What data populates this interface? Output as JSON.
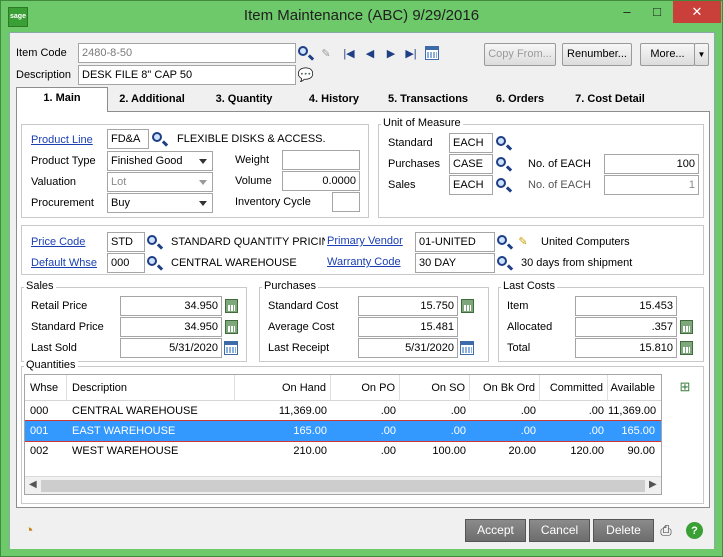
{
  "window": {
    "title": "Item Maintenance (ABC) 9/29/2016",
    "logo": "sage",
    "minimize": "–",
    "maximize": "□",
    "close": "✕"
  },
  "header": {
    "item_code_label": "Item Code",
    "item_code_value": "2480-8-50",
    "description_label": "Description",
    "description_value": "DESK FILE 8\" CAP 50",
    "copy_from": "Copy From...",
    "renumber": "Renumber...",
    "more": "More...",
    "more_arrow": "▼"
  },
  "tabs": [
    {
      "label": "1. Main"
    },
    {
      "label": "2. Additional"
    },
    {
      "label": "3. Quantity"
    },
    {
      "label": "4. History"
    },
    {
      "label": "5. Transactions"
    },
    {
      "label": "6. Orders"
    },
    {
      "label": "7. Cost Detail"
    }
  ],
  "main": {
    "product_line_label": "Product Line",
    "product_line_value": "FD&A",
    "product_line_desc": "FLEXIBLE DISKS & ACCESS.",
    "product_type_label": "Product Type",
    "product_type_value": "Finished Good",
    "valuation_label": "Valuation",
    "valuation_value": "Lot",
    "procurement_label": "Procurement",
    "procurement_value": "Buy",
    "weight_label": "Weight",
    "weight_value": "",
    "volume_label": "Volume",
    "volume_value": "0.0000",
    "inventory_cycle_label": "Inventory Cycle",
    "inventory_cycle_value": "",
    "uom": {
      "title": "Unit of Measure",
      "standard_label": "Standard",
      "standard_value": "EACH",
      "purchases_label": "Purchases",
      "purchases_value": "CASE",
      "sales_label": "Sales",
      "sales_value": "EACH",
      "no_of_each_label_1": "No. of  EACH",
      "no_of_each_value_1": "100",
      "no_of_each_label_2": "No. of  EACH",
      "no_of_each_value_2": "1"
    },
    "price_code_label": "Price Code",
    "price_code_value": "STD",
    "price_code_desc": "STANDARD QUANTITY PRICING",
    "default_whse_label": "Default Whse",
    "default_whse_value": "000",
    "default_whse_desc": "CENTRAL WAREHOUSE",
    "primary_vendor_label": "Primary Vendor",
    "primary_vendor_value": "01-UNITED",
    "primary_vendor_desc": "United Computers",
    "warranty_code_label": "Warranty Code",
    "warranty_code_value": "30 DAY",
    "warranty_code_desc": "30 days from shipment",
    "sales": {
      "title": "Sales",
      "retail_price_label": "Retail Price",
      "retail_price_value": "34.950",
      "standard_price_label": "Standard Price",
      "standard_price_value": "34.950",
      "last_sold_label": "Last Sold",
      "last_sold_value": "5/31/2020"
    },
    "purchases": {
      "title": "Purchases",
      "standard_cost_label": "Standard Cost",
      "standard_cost_value": "15.750",
      "average_cost_label": "Average Cost",
      "average_cost_value": "15.481",
      "last_receipt_label": "Last Receipt",
      "last_receipt_value": "5/31/2020"
    },
    "last_costs": {
      "title": "Last Costs",
      "item_label": "Item",
      "item_value": "15.453",
      "allocated_label": "Allocated",
      "allocated_value": ".357",
      "total_label": "Total",
      "total_value": "15.810"
    },
    "quantities": {
      "title": "Quantities",
      "columns": [
        "Whse",
        "Description",
        "On Hand",
        "On PO",
        "On SO",
        "On Bk Ord",
        "Committed",
        "Available"
      ],
      "rows": [
        [
          "000",
          "CENTRAL WAREHOUSE",
          "11,369.00",
          ".00",
          ".00",
          ".00",
          ".00",
          "11,369.00"
        ],
        [
          "001",
          "EAST WAREHOUSE",
          "165.00",
          ".00",
          ".00",
          ".00",
          ".00",
          "165.00"
        ],
        [
          "002",
          "WEST WAREHOUSE",
          "210.00",
          ".00",
          "100.00",
          "20.00",
          "120.00",
          "90.00"
        ]
      ],
      "selected_row": 1
    }
  },
  "footer": {
    "accept": "Accept",
    "cancel": "Cancel",
    "delete": "Delete"
  },
  "icons": [
    "search-icon",
    "notes-icon",
    "first-record-icon",
    "previous-record-icon",
    "next-record-icon",
    "last-record-icon",
    "calendar-icon",
    "calculator-icon",
    "print-icon",
    "help-icon"
  ]
}
